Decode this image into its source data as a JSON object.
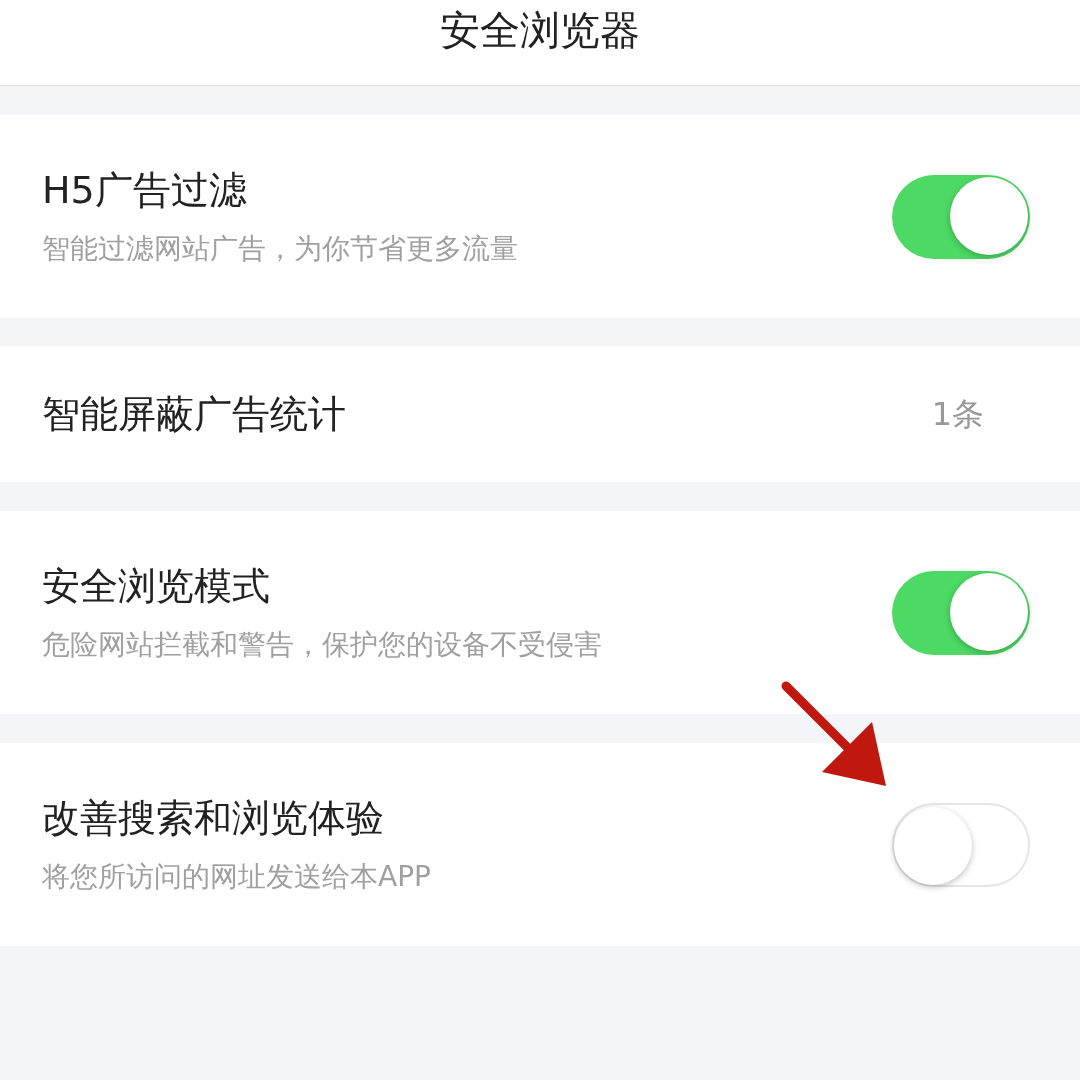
{
  "header": {
    "title": "安全浏览器"
  },
  "settings": [
    {
      "kind": "toggle",
      "label": "H5广告过滤",
      "description": "智能过滤网站广告，为你节省更多流量",
      "on": true
    },
    {
      "kind": "value",
      "label": "智能屏蔽广告统计",
      "value": "1条"
    },
    {
      "kind": "toggle",
      "label": "安全浏览模式",
      "description": "危险网站拦截和警告，保护您的设备不受侵害",
      "on": true
    },
    {
      "kind": "toggle",
      "label": "改善搜索和浏览体验",
      "description": "将您所访问的网址发送给本APP",
      "on": false
    }
  ]
}
